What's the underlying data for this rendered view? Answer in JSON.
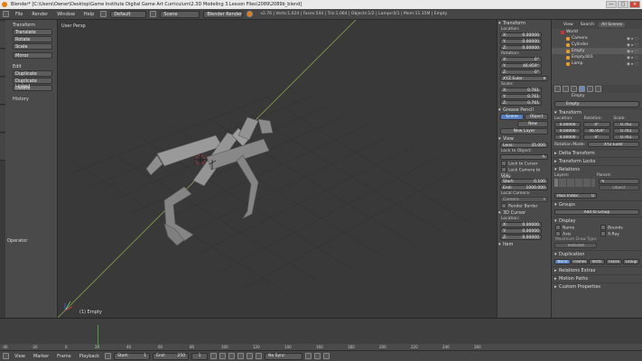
{
  "titlebar": {
    "title": "Blender* [C:\\Users\\Owner\\Desktop\\Game Institute Digital Game Art Curriculum\\2.3D Modeling 3.Lesson Files\\2089\\2089b_blend]",
    "buttons": [
      "—",
      "□",
      "✕"
    ]
  },
  "infobar": {
    "menus": [
      "File",
      "Render",
      "Window",
      "Help"
    ],
    "layout": "Default",
    "scene": "Scene",
    "engine": "Blender Render",
    "stats": "v2.76 | Verts:1,024 | Faces:544 | Tris:1,064 | Objects:1/2 | Lamps:0/1 | Mem:11.35M | Empty"
  },
  "toolshelf": {
    "transform_header": "Transform",
    "transform_tools": [
      "Translate",
      "Rotate",
      "Scale",
      "Mirror"
    ],
    "edit_header": "Edit",
    "edit_tools": [
      "Duplicate",
      "Duplicate Linked",
      "Delete"
    ],
    "history_header": "History",
    "operator_header": "Operator",
    "status": "Rot 46.95 global"
  },
  "viewport": {
    "view_label": "User Persp",
    "selection_label": "(1) Empty"
  },
  "npanel": {
    "transform": "Transform",
    "location": "Location:",
    "loc": [
      {
        "a": "X:",
        "v": "0.00000"
      },
      {
        "a": "Y:",
        "v": "0.00000"
      },
      {
        "a": "Z:",
        "v": "0.00000"
      }
    ],
    "rotation": "Rotation:",
    "rot": [
      {
        "a": "X:",
        "v": "0°"
      },
      {
        "a": "Y:",
        "v": "46.959°"
      },
      {
        "a": "Z:",
        "v": "0°"
      }
    ],
    "rot_mode": "XYZ Euler",
    "scale": "Scale:",
    "scl": [
      {
        "a": "X:",
        "v": "0.761"
      },
      {
        "a": "Y:",
        "v": "0.761"
      },
      {
        "a": "Z:",
        "v": "0.761"
      }
    ],
    "grease_pencil": "Grease Pencil",
    "gp_scene": "Scene",
    "gp_object": "Object",
    "gp_new": "New",
    "gp_new_layer": "New Layer",
    "view": "View",
    "lens": "Lens:",
    "lens_val": "35.000",
    "lock_to_object": "Lock to Object:",
    "lock_to_cursor": "Lock to Cursor",
    "lock_camera": "Lock Camera to View",
    "clip": "Clip:",
    "clip_start": "Start:",
    "clip_start_val": "0.100",
    "clip_end": "End:",
    "clip_end_val": "1000.000",
    "local_camera": "Local Camera:",
    "camera": "Camera",
    "render_border": "Render Border",
    "cursor_3d": "3D Cursor",
    "cursor_loc": "Location:",
    "cur": [
      {
        "a": "X:",
        "v": "0.00000"
      },
      {
        "a": "Y:",
        "v": "0.00000"
      },
      {
        "a": "Z:",
        "v": "0.00000"
      }
    ],
    "item": "Item"
  },
  "outliner": {
    "tabs": [
      "View",
      "Search",
      "All Scenes"
    ],
    "rows": [
      "World",
      "Camera",
      "Cylinder",
      "Empty",
      "Empty.001",
      "Lamp"
    ]
  },
  "properties": {
    "object_name": "Empty",
    "transform": "Transform",
    "location": "Location:",
    "rotation": "Rotation:",
    "scale": "Scale:",
    "loc_vals": [
      "0.00000",
      "0.00000",
      "0.00000"
    ],
    "rot_vals": [
      "0°",
      "46.959°",
      "0°"
    ],
    "scl_vals": [
      "0.761",
      "0.761",
      "0.761"
    ],
    "rotation_mode": "Rotation Mode:",
    "rotation_mode_val": "XYZ Euler",
    "delta_transform": "Delta Transform",
    "transform_locks": "Transform Locks",
    "relations": "Relations",
    "layers": "Layers:",
    "parent": "Parent:",
    "parent_type": "Object",
    "pass_index": "Pass Index:",
    "pass_index_val": "0",
    "groups": "Groups",
    "add_to_group": "Add to Group",
    "display": "Display",
    "name": "Name",
    "axis": "Axis",
    "bounds": "Bounds",
    "xray": "X-Ray",
    "max_draw_type": "Maximum Draw Type:",
    "draw_type": "Textured",
    "duplication": "Duplication",
    "dup_tabs": [
      "None",
      "Frames",
      "Verts",
      "Faces",
      "Group"
    ],
    "relations_extras": "Relations Extras",
    "motion_paths": "Motion Paths",
    "custom_properties": "Custom Properties"
  },
  "timeline": {
    "ruler": [
      "-40",
      "-20",
      "0",
      "20",
      "40",
      "60",
      "80",
      "100",
      "120",
      "140",
      "160",
      "180",
      "200",
      "220",
      "240",
      "260"
    ]
  },
  "bottombar": {
    "menus": [
      "View",
      "Marker",
      "Frame",
      "Playback"
    ],
    "start": "Start:",
    "start_val": "1",
    "end": "End:",
    "end_val": "250",
    "current": "1",
    "sync": "No Sync"
  }
}
